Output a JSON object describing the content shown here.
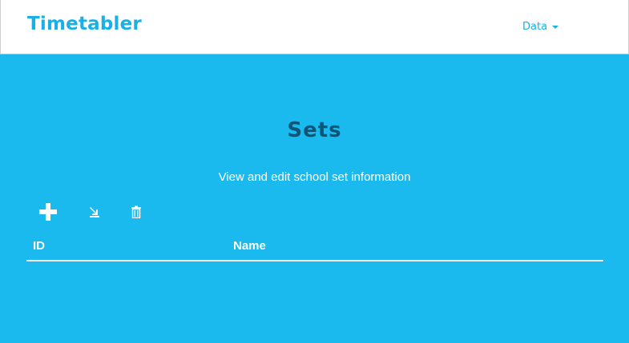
{
  "navbar": {
    "brand": "Timetabler",
    "menu": {
      "label": "Data"
    }
  },
  "page": {
    "title": "Sets",
    "subtitle": "View and edit school set information"
  },
  "toolbar": {
    "icons": [
      "plus-icon",
      "import-icon",
      "trash-icon"
    ]
  },
  "table": {
    "columns": [
      "ID",
      "Name"
    ],
    "rows": []
  },
  "colors": {
    "background": "#1ab9ee",
    "brand": "#1ab0e6",
    "title": "#0d5677",
    "text": "#ffffff"
  }
}
